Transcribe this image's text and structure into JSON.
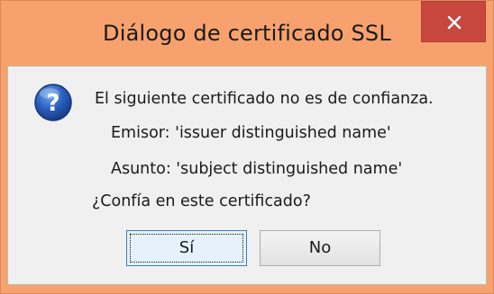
{
  "window": {
    "title": "Diálogo de certificado SSL",
    "close_icon": "close-icon",
    "accent": "#f7a26e",
    "close_color": "#c7473f"
  },
  "message": {
    "icon": "question-icon",
    "line1": "El siguiente certificado no es de confianza.",
    "line2": "Emisor: 'issuer distinguished name'",
    "line3": "Asunto: 'subject distinguished name'",
    "question": "¿Confía en este certificado?"
  },
  "buttons": {
    "yes_label": "Sí",
    "no_label": "No"
  }
}
